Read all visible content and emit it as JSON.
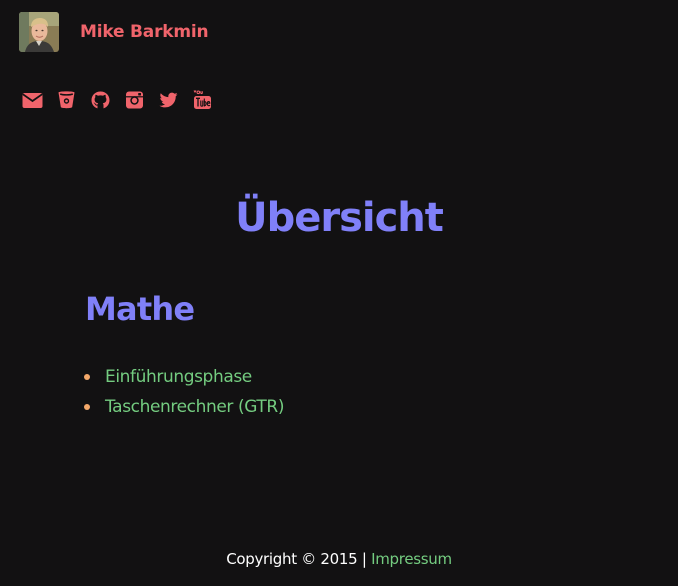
{
  "header": {
    "avatar_icon": "person-photo",
    "site_name": "Mike Barkmin"
  },
  "social": {
    "color": "#f0646b",
    "icons": [
      "envelope-icon",
      "bitbucket-icon",
      "github-icon",
      "instagram-icon",
      "twitter-icon",
      "youtube-icon"
    ]
  },
  "main": {
    "title": "Übersicht",
    "section_title": "Mathe",
    "links": [
      {
        "label": "Einführungsphase"
      },
      {
        "label": "Taschenrechner (GTR)"
      }
    ]
  },
  "footer": {
    "copyright": "Copyright © 2015",
    "separator": "|",
    "impressum_label": "Impressum"
  },
  "colors": {
    "background": "#121112",
    "accent_red": "#f0646b",
    "heading": "#8080f8",
    "link": "#74cc80",
    "bullet": "#f3a86a"
  }
}
